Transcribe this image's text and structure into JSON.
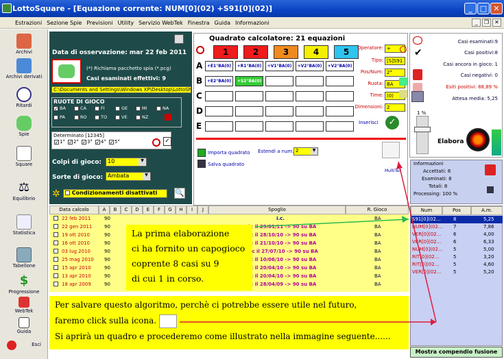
{
  "window": {
    "title": "LottoSquare - [Equazione corrente: NUM[0](02) +S91[0](02)]"
  },
  "menu": [
    "Estrazioni",
    "Sezione Spie",
    "Previsioni",
    "Utility",
    "Servizio WebTek",
    "Finestra",
    "Guida",
    "Informazioni"
  ],
  "sidebar": [
    {
      "label": "Archivi"
    },
    {
      "label": "Archivi derivati"
    },
    {
      "label": "Ritardi"
    },
    {
      "label": "Spie"
    },
    {
      "label": "Square"
    },
    {
      "label": "Equilibrio"
    },
    {
      "label": "Statistica"
    },
    {
      "label": "Tabellone"
    },
    {
      "label": "Progressione"
    },
    {
      "label": "WebTek"
    },
    {
      "label": "Guida"
    },
    {
      "label": "Esci"
    }
  ],
  "config": {
    "data_label": "Data di osservazione:",
    "data_value": "mar 22 feb 2011",
    "spia_note": "(*) Richiama pacchetto spia (*.pcg)",
    "casi_label": "Casi esaminati effettivi: 9",
    "path": "C:\\Documents and Settings\\Windows XP\\Desktop\\LottoSha",
    "ruote_title": "RUOTE DI GIOCO",
    "ruote": [
      "BA",
      "CA",
      "FI",
      "GE",
      "MI",
      "NA",
      "PA",
      "RO",
      "TO",
      "VE",
      "NZ"
    ],
    "determinato_title": "Determinato [12345]",
    "determinato": [
      "1°",
      "2°",
      "3°",
      "4°",
      "5°"
    ],
    "colpi_label": "Colpi di gioco:",
    "colpi_value": "10",
    "sorte_label": "Sorte di gioco:",
    "sorte_value": "Ambata",
    "condizionamenti": "Condizionamenti disattivati"
  },
  "quadrato": {
    "title": "Quadrato calcolatore: 21 equazioni",
    "numeri": [
      "1",
      "2",
      "3",
      "4",
      "5"
    ],
    "colors": [
      "#ee1c1c",
      "#ee1c1c",
      "#f08a1e",
      "#f4f000",
      "#2ec4f0"
    ],
    "row_labels": [
      "A",
      "B",
      "C",
      "D",
      "E"
    ],
    "rowA": [
      "+E1°BA(0)",
      "+R1°BA(0)",
      "+V1°BA(0)",
      "+V2°BA(0)",
      "+V2°BA(0)"
    ],
    "rowB": [
      "+E2°BA(0)",
      "+S2°BA(0)",
      "",
      "",
      ""
    ],
    "operatore_label": "Operatore:",
    "operatore": "+",
    "tipo_label": "Tipo:",
    "tipo": "[S]S91",
    "posnum_label": "Pos/Num:",
    "posnum": "2°",
    "ruota_label": "Ruota:",
    "ruota": "BA",
    "time_label": "Time:",
    "time": "(0)",
    "dim_label": "Dimensioni:",
    "dim": "2",
    "inserisci": "Inserisci",
    "importa": "Importa quadrato",
    "salva": "Salva quadrato",
    "estendi": "Estendi a num.:",
    "estendi_value": "2",
    "multitex": "MultiTex"
  },
  "stats": {
    "casi_esaminati": "Casi esaminati:9",
    "casi_positivi": "Casi positivi:8",
    "casi_gioco": "Casi ancora in gioco: 1",
    "casi_negativi": "Casi negativi: 0",
    "esiti": "Esiti positivi: 88,89 %",
    "attesa": "Attesa media: 5,25",
    "percent": "1 %",
    "elabora": "Elabora"
  },
  "info": {
    "title": "Informazioni",
    "accettati": "Accettati:  8",
    "esaminati": "Esaminati:  8",
    "totali": "Totali:  8",
    "processing": "Processing:   100 %"
  },
  "tableA": {
    "headers": [
      "Data calcolo",
      "A",
      "B",
      "C",
      "D",
      "E",
      "F",
      "G",
      "H",
      "I",
      "J",
      "Spoglio",
      "R. Gioco"
    ],
    "rows": [
      {
        "d": "22 feb 2011",
        "a": "90",
        "s": "i.c.",
        "r": "BA"
      },
      {
        "d": "22 gen 2011",
        "a": "90",
        "s": "3°c il 29/01/11 -> 90 su BA",
        "r": "BA"
      },
      {
        "d": "19 ott 2010",
        "a": "90",
        "s": "4°c il 28/10/10 -> 90 su BA",
        "r": "BA"
      },
      {
        "d": "16 ott 2010",
        "a": "90",
        "s": "2°c il 21/10/10 -> 90 su BA",
        "r": "BA"
      },
      {
        "d": "03 lug 2010",
        "a": "90",
        "s": "10°c il 27/07/10 -> 90 su BA",
        "r": "BA"
      },
      {
        "d": "25 mag 2010",
        "a": "90",
        "s": "7°c il 10/06/10 -> 90 su BA",
        "r": "BA"
      },
      {
        "d": "15 apr 2010",
        "a": "90",
        "s": "2°c il 20/04/10 -> 90 su BA",
        "r": "BA"
      },
      {
        "d": "13 apr 2010",
        "a": "90",
        "s": "4°c il 20/04/10 -> 90 su BA",
        "r": "BA"
      },
      {
        "d": "18 apr 2009",
        "a": "90",
        "s": "4°c il 28/04/09 -> 90 su BA",
        "r": "BA"
      }
    ]
  },
  "tableB": {
    "headers": [
      "Num",
      "Pos",
      "A.m."
    ],
    "rows": [
      [
        "S91[0](02...",
        "8",
        "5,25"
      ],
      [
        "NUM[0](02...",
        "7",
        "7,86"
      ],
      [
        "VER[0](02...",
        "6",
        "4,00"
      ],
      [
        "VER[0](02...",
        "6",
        "6,33"
      ],
      [
        "NUM[0](02...",
        "5",
        "5,00"
      ],
      [
        "RIT[0](02...",
        "5",
        "3,20"
      ],
      [
        "RIT[0](02...",
        "5",
        "4,60"
      ],
      [
        "VER[0](02...",
        "5",
        "5,20"
      ]
    ],
    "mostra": "Mostra compendio fusione"
  },
  "notes": {
    "n1": [
      "La prima elaborazione",
      "ci ha fornito un capogioco",
      "coprente 8 casi su 9",
      "di cui 1 in corso."
    ],
    "n2": [
      "Per salvare questo algoritmo, perchè ci potrebbe essere utile nel futuro,",
      "faremo click sulla icona.",
      "Si aprirà un quadro e procederemo come illustrato nella immagine seguente......"
    ]
  }
}
